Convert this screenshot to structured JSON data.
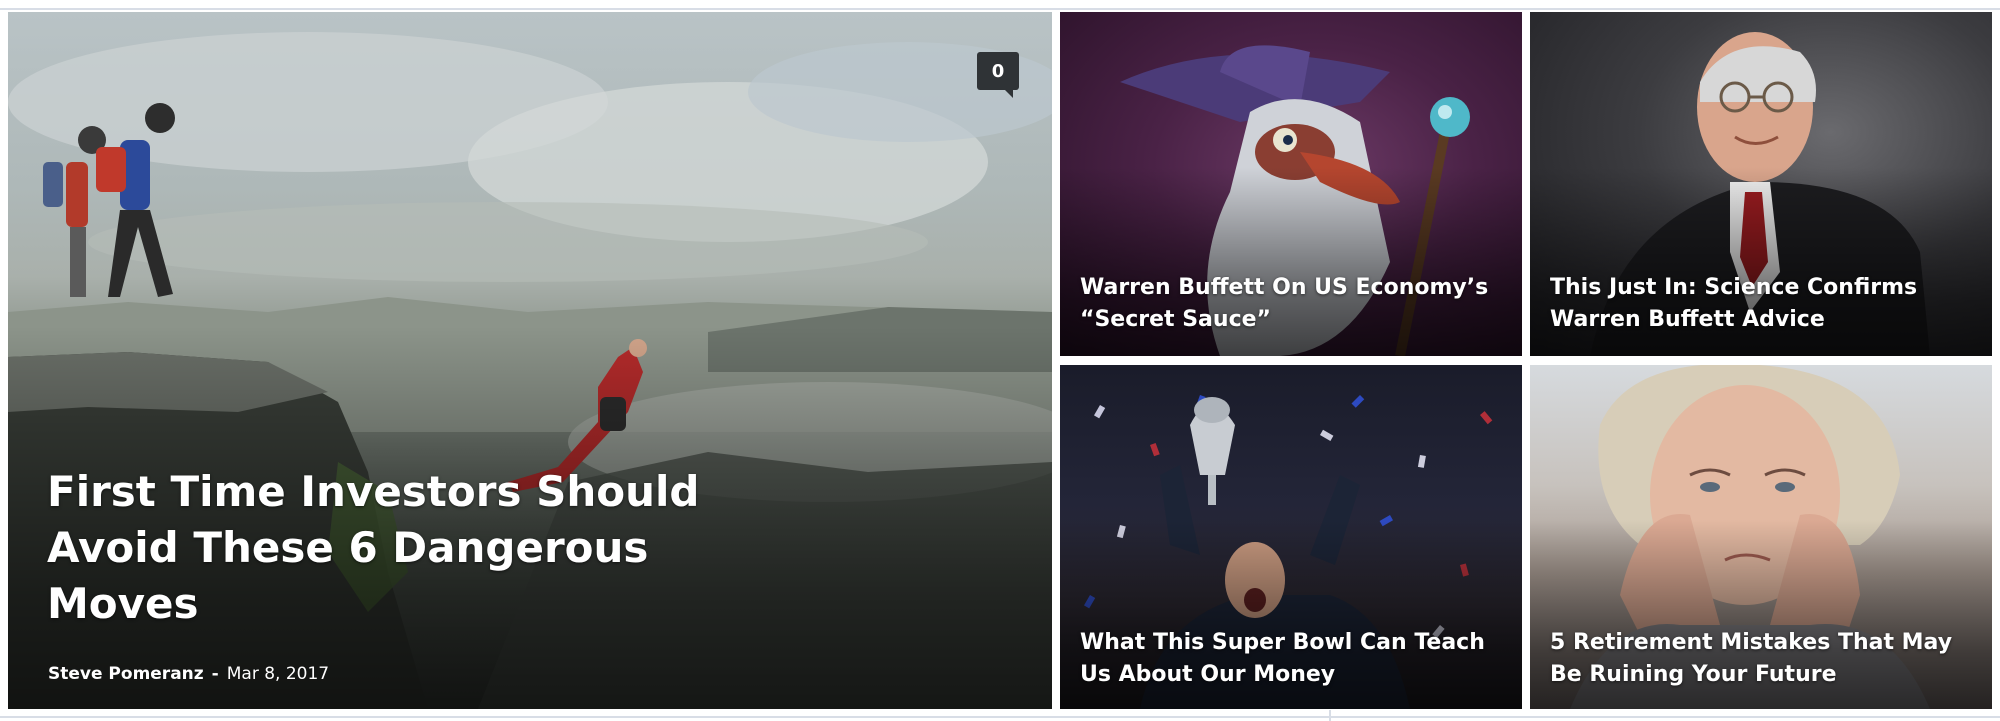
{
  "hero": {
    "title": "First Time Investors Should Avoid These 6 Dangerous Moves",
    "author": "Steve Pomeranz",
    "separator": "-",
    "date": "Mar 8, 2017",
    "comment_count": "0"
  },
  "tiles": [
    {
      "title": "Warren Buffett On US Economy’s “Secret Sauce”",
      "image": "wizard-illustration"
    },
    {
      "title": "This Just In: Science Confirms Warren Buffett Advice",
      "image": "portrait-man-in-suit"
    },
    {
      "title": "What This Super Bowl Can Teach Us About Our Money",
      "image": "football-player-trophy-confetti"
    },
    {
      "title": "5 Retirement Mistakes That May Be Ruining Your Future",
      "image": "worried-elderly-woman"
    }
  ],
  "colors": {
    "badge_bg": "#2f3336",
    "title_text": "#ffffff",
    "frame_line": "#d8dde6"
  }
}
